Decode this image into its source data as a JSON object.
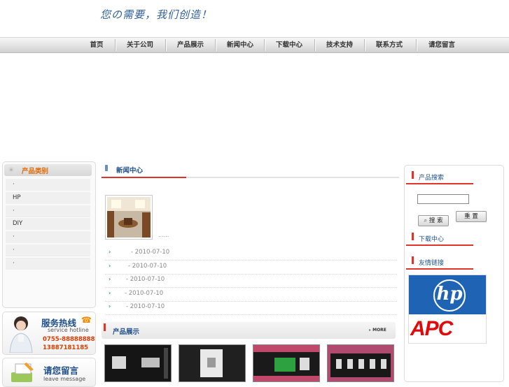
{
  "header": {
    "slogan": "您の需要，我们创造！"
  },
  "nav": [
    {
      "label": "首页"
    },
    {
      "label": "关于公司"
    },
    {
      "label": "产品展示"
    },
    {
      "label": "新闻中心"
    },
    {
      "label": "下载中心"
    },
    {
      "label": "技术支持"
    },
    {
      "label": "联系方式"
    },
    {
      "label": "请您留言"
    }
  ],
  "sidebar": {
    "category_title": "产品类别",
    "categories": [
      "·",
      "HP",
      "·",
      "DIY",
      "·",
      "·",
      "·"
    ],
    "hotline": {
      "title": "服务热线",
      "subtitle": "service hotline",
      "phone1": "0755-88888888",
      "phone2": "13887181185"
    },
    "message": {
      "title": "请您留言",
      "subtitle": "leave message"
    }
  },
  "news": {
    "title": "新闻中心",
    "ellipsis": "......",
    "items": [
      {
        "date": "- 2010-07-10"
      },
      {
        "date": "- 2010-07-10"
      },
      {
        "date": "- 2010-07-10"
      },
      {
        "date": "- 2010-07-10"
      },
      {
        "date": "- 2010-07-10"
      }
    ]
  },
  "products": {
    "title": "产品展示",
    "more": "MORE"
  },
  "right": {
    "search_title": "产品搜索",
    "search_button": "搜 索",
    "reset_button": "重 置",
    "download_title": "下载中心",
    "links_title": "友情链接",
    "logo_hp": "hp",
    "logo_apc": "APC"
  },
  "colors": {
    "nav_text": "#333333",
    "heading_blue": "#1e4f8a",
    "accent_red": "#e0332a",
    "category_orange": "#e06a00"
  }
}
